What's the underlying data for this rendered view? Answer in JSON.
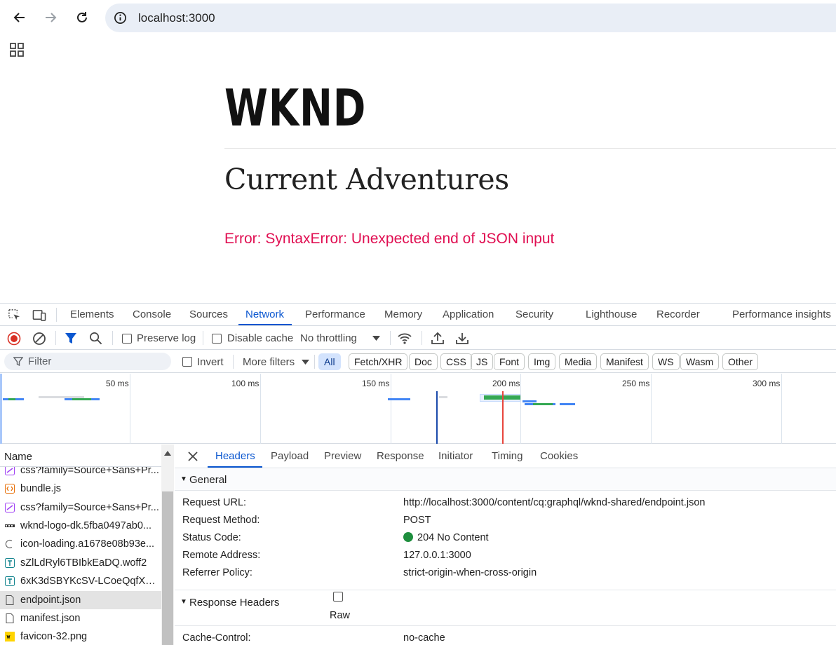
{
  "browser": {
    "url": "localhost:3000"
  },
  "page": {
    "logo": "WKND",
    "heading": "Current Adventures",
    "error": "Error: SyntaxError: Unexpected end of JSON input"
  },
  "devtools": {
    "tabs": [
      "Elements",
      "Console",
      "Sources",
      "Network",
      "Performance",
      "Memory",
      "Application",
      "Security",
      "Lighthouse",
      "Recorder",
      "Performance insights"
    ],
    "active_tab": "Network",
    "toolbar": {
      "preserve_log": "Preserve log",
      "disable_cache": "Disable cache",
      "throttling": "No throttling"
    },
    "filter": {
      "placeholder": "Filter",
      "invert": "Invert",
      "more_filters": "More filters",
      "types": [
        "All",
        "Fetch/XHR",
        "Doc",
        "CSS",
        "JS",
        "Font",
        "Img",
        "Media",
        "Manifest",
        "WS",
        "Wasm",
        "Other"
      ],
      "active_type": "All"
    },
    "overview": {
      "ticks": [
        "50 ms",
        "100 ms",
        "150 ms",
        "200 ms",
        "250 ms",
        "300 ms"
      ]
    },
    "requests": {
      "column_header": "Name",
      "items": [
        {
          "name": "css?family=Source+Sans+Pr...",
          "icon": "css-icon"
        },
        {
          "name": "bundle.js",
          "icon": "js-icon"
        },
        {
          "name": "css?family=Source+Sans+Pr...",
          "icon": "css-icon"
        },
        {
          "name": "wknd-logo-dk.5fba0497ab0...",
          "icon": "image-icon"
        },
        {
          "name": "icon-loading.a1678e08b93e...",
          "icon": "loading-icon"
        },
        {
          "name": "sZlLdRyl6TBIbkEaDQ.woff2",
          "icon": "font-icon"
        },
        {
          "name": "6xK3dSBYKcSV-LCoeQqfX1...",
          "icon": "font-icon"
        },
        {
          "name": "endpoint.json",
          "icon": "document-icon"
        },
        {
          "name": "manifest.json",
          "icon": "document-icon"
        },
        {
          "name": "favicon-32.png",
          "icon": "favicon-icon"
        }
      ],
      "selected": "endpoint.json"
    },
    "details": {
      "tabs": [
        "Headers",
        "Payload",
        "Preview",
        "Response",
        "Initiator",
        "Timing",
        "Cookies"
      ],
      "active_tab": "Headers",
      "general": {
        "title": "General",
        "rows": [
          {
            "key": "Request URL:",
            "value": "http://localhost:3000/content/cq:graphql/wknd-shared/endpoint.json"
          },
          {
            "key": "Request Method:",
            "value": "POST"
          },
          {
            "key": "Status Code:",
            "value": "204 No Content"
          },
          {
            "key": "Remote Address:",
            "value": "127.0.0.1:3000"
          },
          {
            "key": "Referrer Policy:",
            "value": "strict-origin-when-cross-origin"
          }
        ]
      },
      "response_headers": {
        "title": "Response Headers",
        "raw_label": "Raw",
        "rows": [
          {
            "key": "Cache-Control:",
            "value": "no-cache"
          }
        ]
      }
    }
  },
  "colors": {
    "accent": "#0b57d0",
    "error": "#e00f52",
    "status_ok": "#1e8e3e",
    "record_red": "#d93025"
  }
}
